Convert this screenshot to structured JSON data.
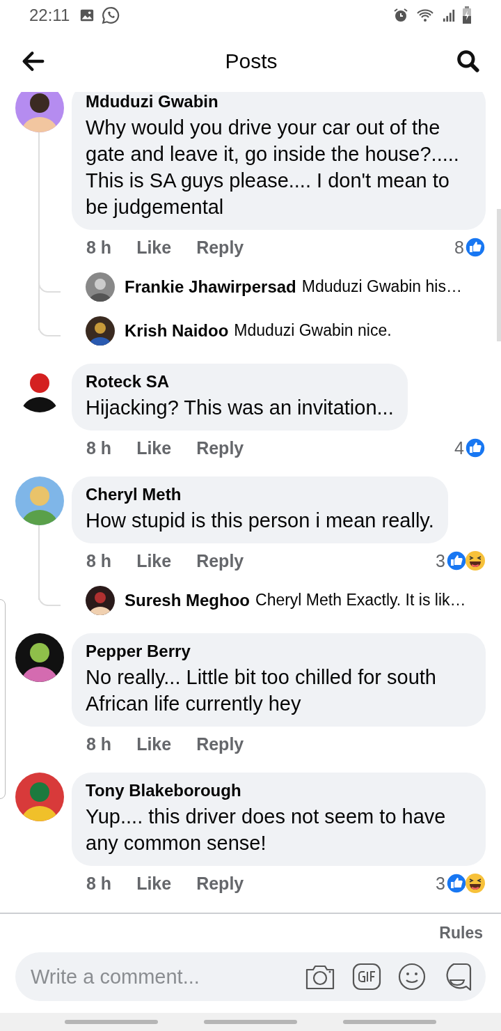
{
  "status_bar": {
    "time": "22:11"
  },
  "header": {
    "title": "Posts"
  },
  "comments": [
    {
      "author": "Mduduzi Gwabin",
      "text": "Why would you drive your car out of the gate and leave it, go inside the house?..... This is SA guys please.... I don't mean to be judgemental",
      "time": "8 h",
      "like": "Like",
      "reply": "Reply",
      "reaction_count": "8",
      "like_reaction": true,
      "haha_reaction": false,
      "replies": [
        {
          "author": "Frankie Jhawirpersad",
          "text": "Mduduzi Gwabin his…"
        },
        {
          "author": "Krish Naidoo",
          "text": "Mduduzi Gwabin nice."
        }
      ]
    },
    {
      "author": "Roteck SA",
      "text": "Hijacking? This was an invitation...",
      "time": "8 h",
      "like": "Like",
      "reply": "Reply",
      "reaction_count": "4",
      "like_reaction": true,
      "haha_reaction": false
    },
    {
      "author": "Cheryl Meth",
      "text": "How stupid is this person i mean really.",
      "time": "8 h",
      "like": "Like",
      "reply": "Reply",
      "reaction_count": "3",
      "like_reaction": true,
      "haha_reaction": true,
      "replies": [
        {
          "author": "Suresh Meghoo",
          "text": "Cheryl Meth Exactly. It is lik…"
        }
      ]
    },
    {
      "author": "Pepper Berry",
      "text": "No really... Little bit too chilled for south African life currently hey",
      "time": "8 h",
      "like": "Like",
      "reply": "Reply",
      "like_reaction": false,
      "haha_reaction": false
    },
    {
      "author": "Tony Blakeborough",
      "text": "Yup.... this driver does not seem to have any common sense!",
      "time": "8 h",
      "like": "Like",
      "reply": "Reply",
      "reaction_count": "3",
      "like_reaction": true,
      "haha_reaction": true
    }
  ],
  "footer": {
    "rules": "Rules",
    "composer": {
      "placeholder": "Write a comment..."
    }
  }
}
